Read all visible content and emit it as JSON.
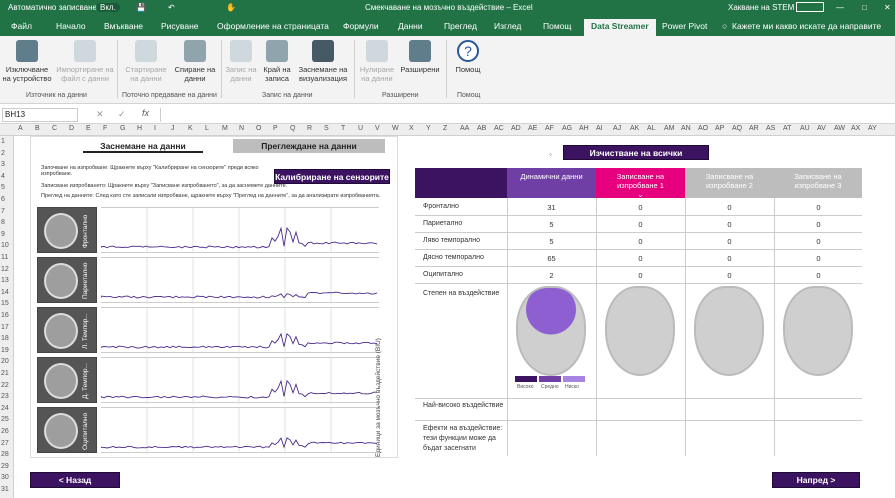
{
  "titlebar": {
    "autosave": "Автоматично записване",
    "autosave_state": "Вкл.",
    "doc_title": "Смекчаване на мозъчно въздействие – Excel",
    "user": "Хакване на STEM"
  },
  "tabs": [
    "Файл",
    "Начало",
    "Вмъкване",
    "Рисуване",
    "Оформление на страницата",
    "Формули",
    "Данни",
    "Преглед",
    "Изглед",
    "Помощ",
    "Data Streamer",
    "Power Pivot"
  ],
  "tell_me": "Кажете ми какво искате да направите",
  "ribbon": {
    "buttons": [
      {
        "label": "Изключване на устройство",
        "enabled": true
      },
      {
        "label": "Импортиране на файл с данни",
        "enabled": false
      },
      {
        "label": "Стартиране на данни",
        "enabled": false
      },
      {
        "label": "Спиране на данни",
        "enabled": true
      },
      {
        "label": "Запис на данни",
        "enabled": false
      },
      {
        "label": "Край на записа",
        "enabled": true
      },
      {
        "label": "Заснемане на визуализация",
        "enabled": true
      },
      {
        "label": "Нулиране на данни",
        "enabled": false
      },
      {
        "label": "Разширени",
        "enabled": true
      },
      {
        "label": "Помощ",
        "enabled": true
      }
    ],
    "groups": [
      "Източник на данни",
      "Поточно предаване на данни",
      "Запис на данни",
      "Разширени",
      "Помощ"
    ]
  },
  "formula_bar": {
    "name_box": "BH13",
    "fx": "fx",
    "value": ""
  },
  "columns": [
    "A",
    "B",
    "C",
    "D",
    "E",
    "F",
    "G",
    "H",
    "I",
    "J",
    "K",
    "L",
    "M",
    "N",
    "O",
    "P",
    "Q",
    "R",
    "S",
    "T",
    "U",
    "V",
    "W",
    "X",
    "Y",
    "Z",
    "AA",
    "AB",
    "AC",
    "AD",
    "AE",
    "AF",
    "AG",
    "AH",
    "AI",
    "AJ",
    "AK",
    "AL",
    "AM",
    "AN",
    "AO",
    "AP",
    "AQ",
    "AR",
    "AS",
    "AT",
    "AU",
    "AV",
    "AW",
    "AX",
    "AY"
  ],
  "rows": [
    "1",
    "2",
    "3",
    "4",
    "5",
    "6",
    "7",
    "8",
    "9",
    "10",
    "11",
    "12",
    "13",
    "14",
    "15",
    "16",
    "17",
    "18",
    "19",
    "20",
    "21",
    "22",
    "23",
    "24",
    "25",
    "26",
    "27",
    "28",
    "29",
    "30",
    "31"
  ],
  "left": {
    "tab_capture": "Заснемане на данни",
    "tab_review": "Преглеждане на данни",
    "instructions": [
      "Започване на изпробване: Щракнете върху \"Калибриране на сензорите\" преди всяко изпробване.",
      "Записване изпробването: Щракнете върху \"Записване изпробването\", за да заснемете данните.",
      "Преглед на данните: След като сте записали изпробване, щракнете върху \"Преглед на данните\", за да анализирате изпробванията."
    ],
    "calibrate_btn": "Калибриране на сензорите >",
    "y_axis": "Единици за мозъчно въздействие (BIU)",
    "channels": [
      "Фронтално",
      "Париетално",
      "Л. Темпор...",
      "Д. Темпор...",
      "Оципитално"
    ]
  },
  "right": {
    "clear_btn": "Изчистване на всички изпробвания >",
    "col_headers": [
      "Динамични данни",
      "Записване на изпробване 1",
      "Записване на изпробване 2",
      "Записване на изпробване 3"
    ],
    "row_labels": [
      "Фронтално",
      "Париетално",
      "Ляво темпорално",
      "Дясно темпорално",
      "Оципитално"
    ],
    "values": [
      [
        "31",
        "0",
        "0",
        "0"
      ],
      [
        "5",
        "0",
        "0",
        "0"
      ],
      [
        "5",
        "0",
        "0",
        "0"
      ],
      [
        "65",
        "0",
        "0",
        "0"
      ],
      [
        "2",
        "0",
        "0",
        "0"
      ]
    ],
    "impact_label": "Степен на въздействие",
    "legend": [
      "Високо",
      "Средно",
      "Ниско"
    ],
    "highest_label": "Най-високо въздействие",
    "effects_label": "Ефекти на въздействие: тези функции може да бъдат засегнати"
  },
  "nav": {
    "back": "< Назад",
    "next": "Напред >"
  },
  "colors": {
    "excel_green": "#217346",
    "purple_dark": "#3c1361",
    "purple_mid": "#6f3fa6",
    "pink": "#e6007e",
    "gray_hdr": "#bdbdbd"
  }
}
